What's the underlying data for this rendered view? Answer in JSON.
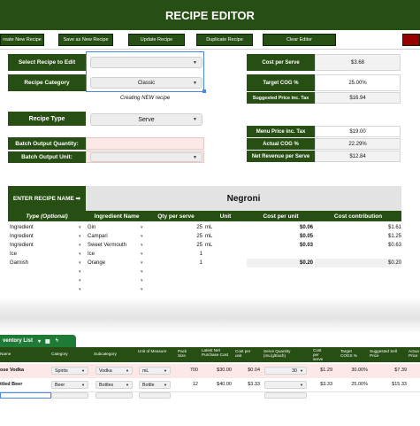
{
  "header": {
    "title": "RECIPE EDITOR"
  },
  "toolbar": {
    "buttons": [
      "reate New Recipe",
      "Save as New Recipe",
      "Update Recipe",
      "Duplicate Recipe",
      "Clear Editor"
    ]
  },
  "form": {
    "select_recipe_label": "Select Recipe to Edit",
    "select_recipe_value": "",
    "recipe_category_label": "Recipe Category",
    "recipe_category_value": "Classic",
    "creating_note": "Creating NEW recipe",
    "recipe_type_label": "Recipe Type",
    "recipe_type_value": "Serve",
    "batch_qty_label": "Batch Output Quantity:",
    "batch_unit_label": "Batch Output Unit:"
  },
  "costs": {
    "cost_per_serve_label": "Cost per Serve",
    "cost_per_serve": "$3.68",
    "target_cog_label": "Target COG %",
    "target_cog": "25.00%",
    "suggested_price_label": "Suggested Price inc. Tax",
    "suggested_price": "$16.94",
    "menu_price_label": "Menu Price inc. Tax",
    "menu_price": "$19.00",
    "actual_cog_label": "Actual COG %",
    "actual_cog": "22.29%",
    "net_revenue_label": "Net Revenue per Serve",
    "net_revenue": "$12.84"
  },
  "recipe": {
    "enter_name_label": "ENTER RECIPE NAME ➡",
    "name": "Negroni",
    "columns": [
      "Type (Optional)",
      "Ingredient Name",
      "Qty per serve",
      "Unit",
      "Cost per unit",
      "Cost contribution"
    ],
    "rows": [
      {
        "type": "Ingredient",
        "name": "Gin",
        "qty": "25",
        "unit": "mL",
        "cost": "$0.06",
        "contrib": "$1.61"
      },
      {
        "type": "Ingredient",
        "name": "Campari",
        "qty": "25",
        "unit": "mL",
        "cost": "$0.05",
        "contrib": "$1.25"
      },
      {
        "type": "Ingredient",
        "name": "Sweet Vermouth",
        "qty": "25",
        "unit": "mL",
        "cost": "$0.03",
        "contrib": "$0.63"
      },
      {
        "type": "Ice",
        "name": "Ice",
        "qty": "1",
        "unit": "",
        "cost": "",
        "contrib": ""
      },
      {
        "type": "Garnish",
        "name": "Orange",
        "qty": "1",
        "unit": "",
        "cost": "$0.20",
        "contrib": "$0.20"
      }
    ]
  },
  "inventory": {
    "tab_label": "ventory List",
    "columns": [
      "Name",
      "Category",
      "Subcategory",
      "Unit of Measure",
      "Pack Size",
      "Latest Net Purchase Cost",
      "Cost per unit",
      "Serve Quantity (mL/g/Each)",
      "Cost per serve",
      "Target COGS %",
      "Suggested Sell Price",
      "Actua Price"
    ],
    "rows": [
      {
        "name": "ose Vodka",
        "category": "Spirits",
        "subcategory": "Vodka",
        "uom": "mL",
        "pack": "700",
        "purchase": "$30.00",
        "cpu": "$0.04",
        "serve_qty": "30",
        "cps": "$1.29",
        "target": "30.00%",
        "suggested": "$7.39"
      },
      {
        "name": "ttled Beer",
        "category": "Beer",
        "subcategory": "Bottles",
        "uom": "Bottle",
        "pack": "12",
        "purchase": "$40.00",
        "cpu": "$3.33",
        "serve_qty": "",
        "cps": "$3.33",
        "target": "25.00%",
        "suggested": "$15.33"
      }
    ]
  },
  "colors": {
    "accent_green": "#274e13",
    "pink_field": "#fce8e6",
    "tab_green": "#1e7a34"
  }
}
